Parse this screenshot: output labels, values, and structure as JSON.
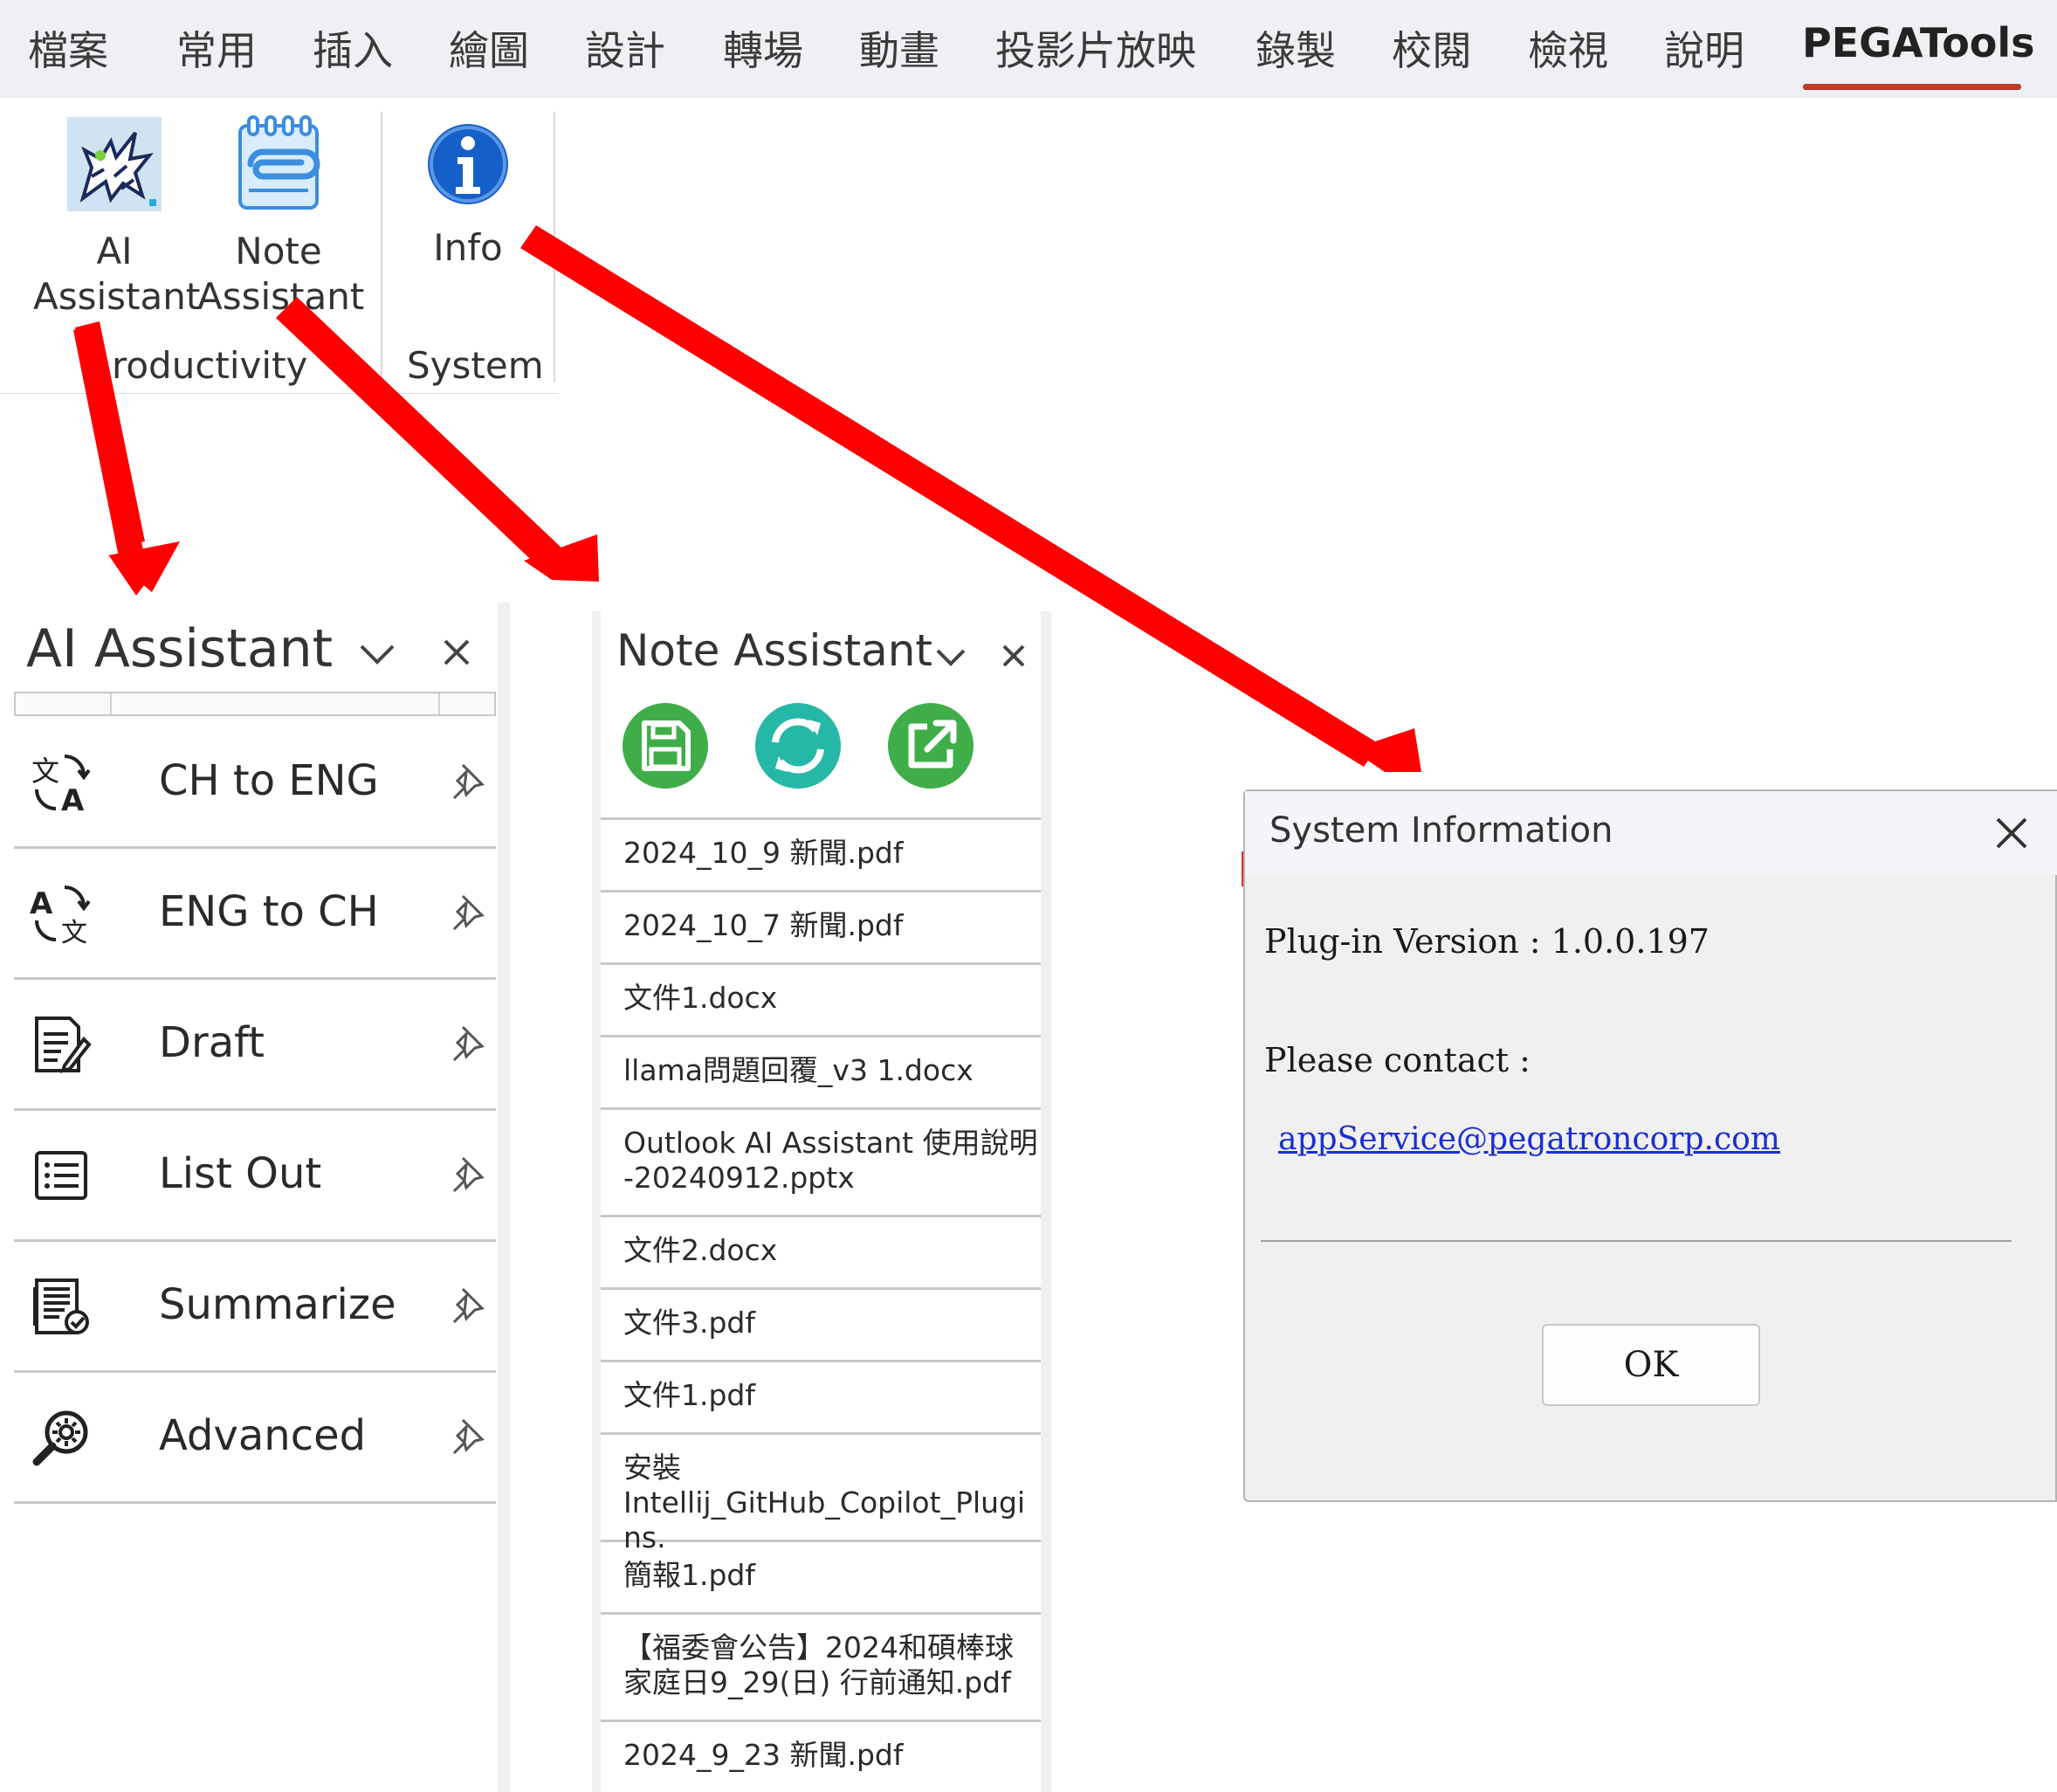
{
  "ribbon": {
    "tabs": [
      "檔案",
      "常用",
      "插入",
      "繪圖",
      "設計",
      "轉場",
      "動畫",
      "投影片放映",
      "錄製",
      "校閱",
      "檢視",
      "說明",
      "PEGATools"
    ],
    "active_tab": "PEGATools",
    "buttons": {
      "ai_assistant": {
        "line1": "AI",
        "line2": "Assistant"
      },
      "note_assistant": {
        "line1": "Note",
        "line2": "Assistant"
      },
      "info": {
        "line1": "Info"
      }
    },
    "groups": {
      "productivity": "roductivity",
      "system": "System"
    }
  },
  "ai_pane": {
    "title": "AI Assistant",
    "items": [
      {
        "label": "CH to ENG",
        "icon": "translate-ch-eng-icon"
      },
      {
        "label": "ENG to CH",
        "icon": "translate-eng-ch-icon"
      },
      {
        "label": "Draft",
        "icon": "draft-icon"
      },
      {
        "label": "List Out",
        "icon": "list-icon"
      },
      {
        "label": "Summarize",
        "icon": "summarize-icon"
      },
      {
        "label": "Advanced",
        "icon": "advanced-settings-icon"
      }
    ]
  },
  "note_pane": {
    "title": "Note Assistant",
    "tools": [
      "save-icon",
      "refresh-icon",
      "open-external-icon"
    ],
    "files": [
      [
        "2024_10_9 新聞.pdf"
      ],
      [
        "2024_10_7 新聞.pdf"
      ],
      [
        "文件1.docx"
      ],
      [
        "llama問題回覆_v3 1.docx"
      ],
      [
        "Outlook AI Assistant 使用說明",
        "-20240912.pptx"
      ],
      [
        "文件2.docx"
      ],
      [
        "文件3.pdf"
      ],
      [
        "文件1.pdf"
      ],
      [
        "安裝",
        "Intellij_GitHub_Copilot_Plugins."
      ],
      [
        "簡報1.pdf"
      ],
      [
        "【福委會公告】2024和碩棒球",
        "家庭日9_29(日) 行前通知.pdf"
      ],
      [
        "2024_9_23 新聞.pdf"
      ]
    ]
  },
  "dialog": {
    "title": "System Information",
    "version_line": "Plug-in Version : 1.0.0.197",
    "contact_label": "Please contact :",
    "email": "appService@pegatroncorp.com",
    "ok_label": "OK"
  },
  "colors": {
    "accent_red": "#e3000f",
    "tab_underline": "#c0392b",
    "note_tool_green": "#3fae49",
    "note_tool_teal": "#26b8a6",
    "info_blue": "#1560c8",
    "link_blue": "#1a2fd1"
  }
}
